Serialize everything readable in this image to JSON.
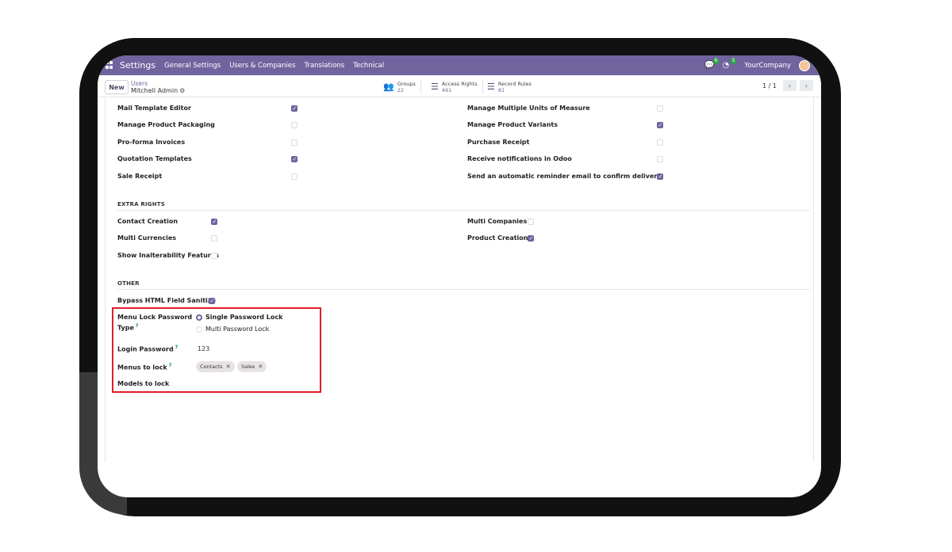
{
  "navbar": {
    "app_title": "Settings",
    "menu": [
      "General Settings",
      "Users & Companies",
      "Translations",
      "Technical"
    ],
    "chat_badge": "6",
    "activity_badge": "5",
    "company": "YourCompany"
  },
  "control_panel": {
    "new_label": "New",
    "breadcrumb_parent": "Users",
    "breadcrumb_current": "Mitchell Admin",
    "stats": [
      {
        "label": "Groups",
        "value": "22"
      },
      {
        "label": "Access Rights",
        "value": "491"
      },
      {
        "label": "Record Rules",
        "value": "81"
      }
    ],
    "pager": "1 / 1"
  },
  "top_rights": {
    "left": [
      {
        "label": "Mail Template Editor",
        "checked": true
      },
      {
        "label": "Manage Product Packaging",
        "checked": false
      },
      {
        "label": "Pro-forma Invoices",
        "checked": false
      },
      {
        "label": "Quotation Templates",
        "checked": true
      },
      {
        "label": "Sale Receipt",
        "checked": false
      }
    ],
    "right": [
      {
        "label": "Manage Multiple Units of Measure",
        "checked": false
      },
      {
        "label": "Manage Product Variants",
        "checked": true
      },
      {
        "label": "Purchase Receipt",
        "checked": false
      },
      {
        "label": "Receive notifications in Odoo",
        "checked": false
      },
      {
        "label": "Send an automatic reminder email to confirm delivery",
        "checked": true
      }
    ]
  },
  "extra_rights": {
    "title": "EXTRA RIGHTS",
    "left": [
      {
        "label": "Contact Creation",
        "checked": true
      },
      {
        "label": "Multi Currencies",
        "checked": false
      },
      {
        "label": "Show Inalterability Features",
        "checked": false
      }
    ],
    "right": [
      {
        "label": "Multi Companies",
        "checked": false
      },
      {
        "label": "Product Creation",
        "checked": true
      }
    ]
  },
  "other": {
    "title": "OTHER",
    "bypass_label": "Bypass HTML Field Sanitize",
    "bypass_checked": true,
    "menu_lock_label_1": "Menu Lock Password",
    "menu_lock_label_2": "Type",
    "help_mark": "?",
    "radio_options": [
      {
        "label": "Single Password Lock",
        "selected": true
      },
      {
        "label": "Multi Password Lock",
        "selected": false
      }
    ],
    "login_password_label": "Login Password",
    "login_password_value": "123",
    "menus_to_lock_label": "Menus to lock",
    "menus_to_lock_tags": [
      "Contacts",
      "Sales"
    ],
    "models_to_lock_label": "Models to lock"
  },
  "colors": {
    "brand": "#71639e",
    "highlight": "#e11d2a"
  }
}
